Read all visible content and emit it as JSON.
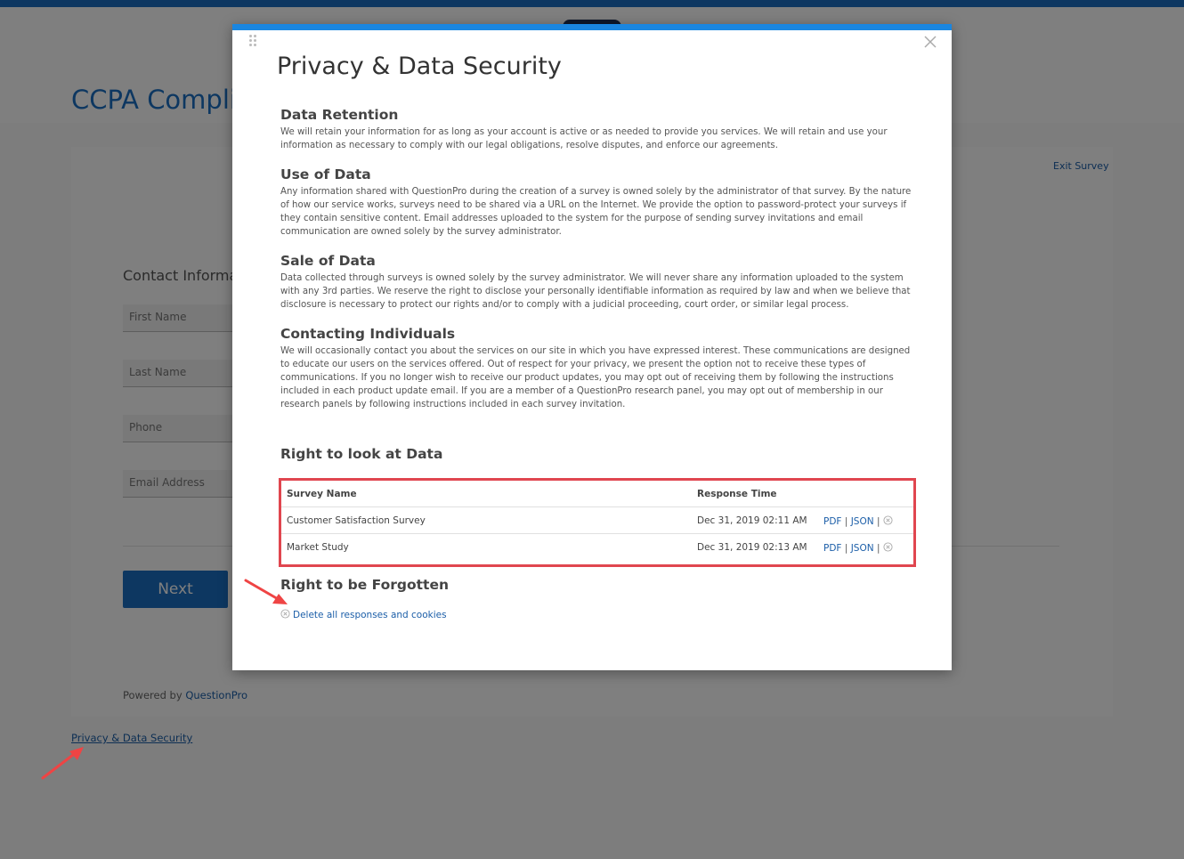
{
  "page": {
    "title": "CCPA Complian",
    "exit_survey": "Exit Survey",
    "contact_heading": "Contact Informat",
    "fields": [
      "First Name",
      "Last Name",
      "Phone",
      "Email Address"
    ],
    "next_button": "Next",
    "powered_by_prefix": "Powered by",
    "powered_by_brand": "QuestionPro",
    "privacy_link": "Privacy & Data Security"
  },
  "modal": {
    "title": "Privacy & Data Security",
    "sections": [
      {
        "heading": "Data Retention",
        "body": "We will retain your information for as long as your account is active or as needed to provide you services. We will retain and use your information as necessary to comply with our legal obligations, resolve disputes, and enforce our agreements."
      },
      {
        "heading": "Use of Data",
        "body": "Any information shared with QuestionPro during the creation of a survey is owned solely by the administrator of that survey. By the nature of how our service works, surveys need to be shared via a URL on the Internet. We provide the option to password-protect your surveys if they contain sensitive content. Email addresses uploaded to the system for the purpose of sending survey invitations and email communication are owned solely by the survey administrator."
      },
      {
        "heading": "Sale of Data",
        "body": "Data collected through surveys is owned solely by the survey administrator. We will never share any information uploaded to the system with any 3rd parties. We reserve the right to disclose your personally identifiable information as required by law and when we believe that disclosure is necessary to protect our rights and/or to comply with a judicial proceeding, court order, or similar legal process."
      },
      {
        "heading": "Contacting Individuals",
        "body": "We will occasionally contact you about the services on our site in which you have expressed interest. These communications are designed to educate our users on the services offered. Out of respect for your privacy, we present the option not to receive these types of communications. If you no longer wish to receive our product updates, you may opt out of receiving them by following the instructions included in each product update email. If you are a member of a QuestionPro research panel, you may opt out of membership in our research panels by following instructions included in each survey invitation."
      }
    ],
    "look_heading": "Right to look at Data",
    "table": {
      "headers": [
        "Survey Name",
        "Response Time"
      ],
      "rows": [
        {
          "name": "Customer Satisfaction Survey",
          "time": "Dec 31, 2019 02:11 AM",
          "pdf": "PDF",
          "json": "JSON"
        },
        {
          "name": "Market Study",
          "time": "Dec 31, 2019 02:13 AM",
          "pdf": "PDF",
          "json": "JSON"
        }
      ],
      "separator": "|"
    },
    "forgotten_heading": "Right to be Forgotten",
    "delete_all": "Delete all responses and cookies"
  },
  "colors": {
    "brand_blue": "#1b6fc2",
    "highlight_red": "#e0464f",
    "link_blue": "#1b5ea8"
  }
}
